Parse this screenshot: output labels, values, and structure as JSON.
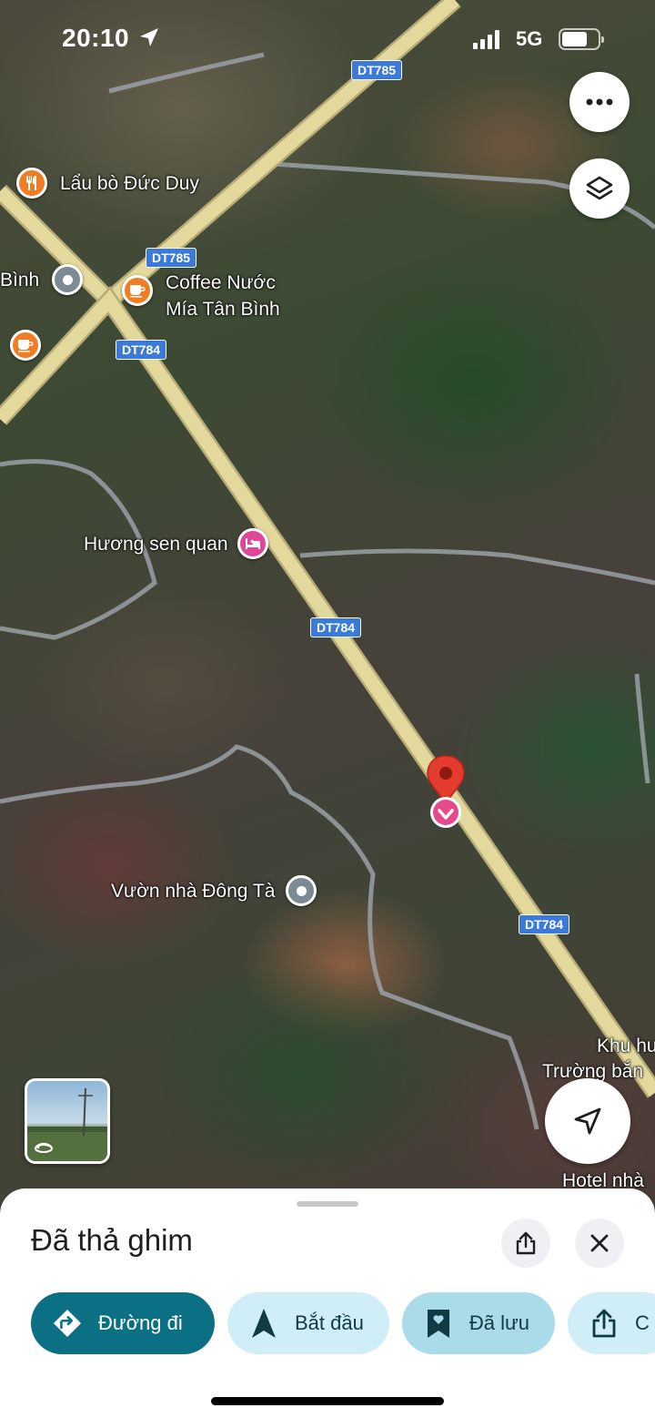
{
  "status_bar": {
    "time": "20:10",
    "network": "5G",
    "battery_percent": 70
  },
  "map": {
    "road_labels": [
      "DT785",
      "DT785",
      "DT784",
      "DT784",
      "DT784"
    ],
    "places": {
      "lau_bo": "Lẩu bò Đức Duy",
      "binh_partial": "Bình",
      "coffee_line1": "Coffee Nước",
      "coffee_line2": "Mía Tân Bình",
      "huong_sen": "Hương sen quan",
      "vuon_nha": "Vườn nhà Đông Tà",
      "khu_partial": "Khu hu",
      "truong_partial": "Trường bắn",
      "hotel_partial": "Hotel nhà"
    },
    "icons": {
      "restaurant": "fork-knife-icon",
      "cafe": "coffee-cup-icon",
      "hotel": "bed-icon",
      "generic": "dot-icon",
      "dropped_pin": "red-pin-icon"
    }
  },
  "sheet": {
    "title": "Đã thả ghim",
    "chips": {
      "directions": "Đường đi",
      "start": "Bắt đầu",
      "saved": "Đã lưu",
      "share_partial": "C"
    }
  },
  "colors": {
    "primary_chip": "#0b7084",
    "light_chip": "#cfeef7",
    "saved_chip": "#a9dbe9",
    "road_shield": "#3b7ad9",
    "dropped_pin": "#e33b2e"
  }
}
